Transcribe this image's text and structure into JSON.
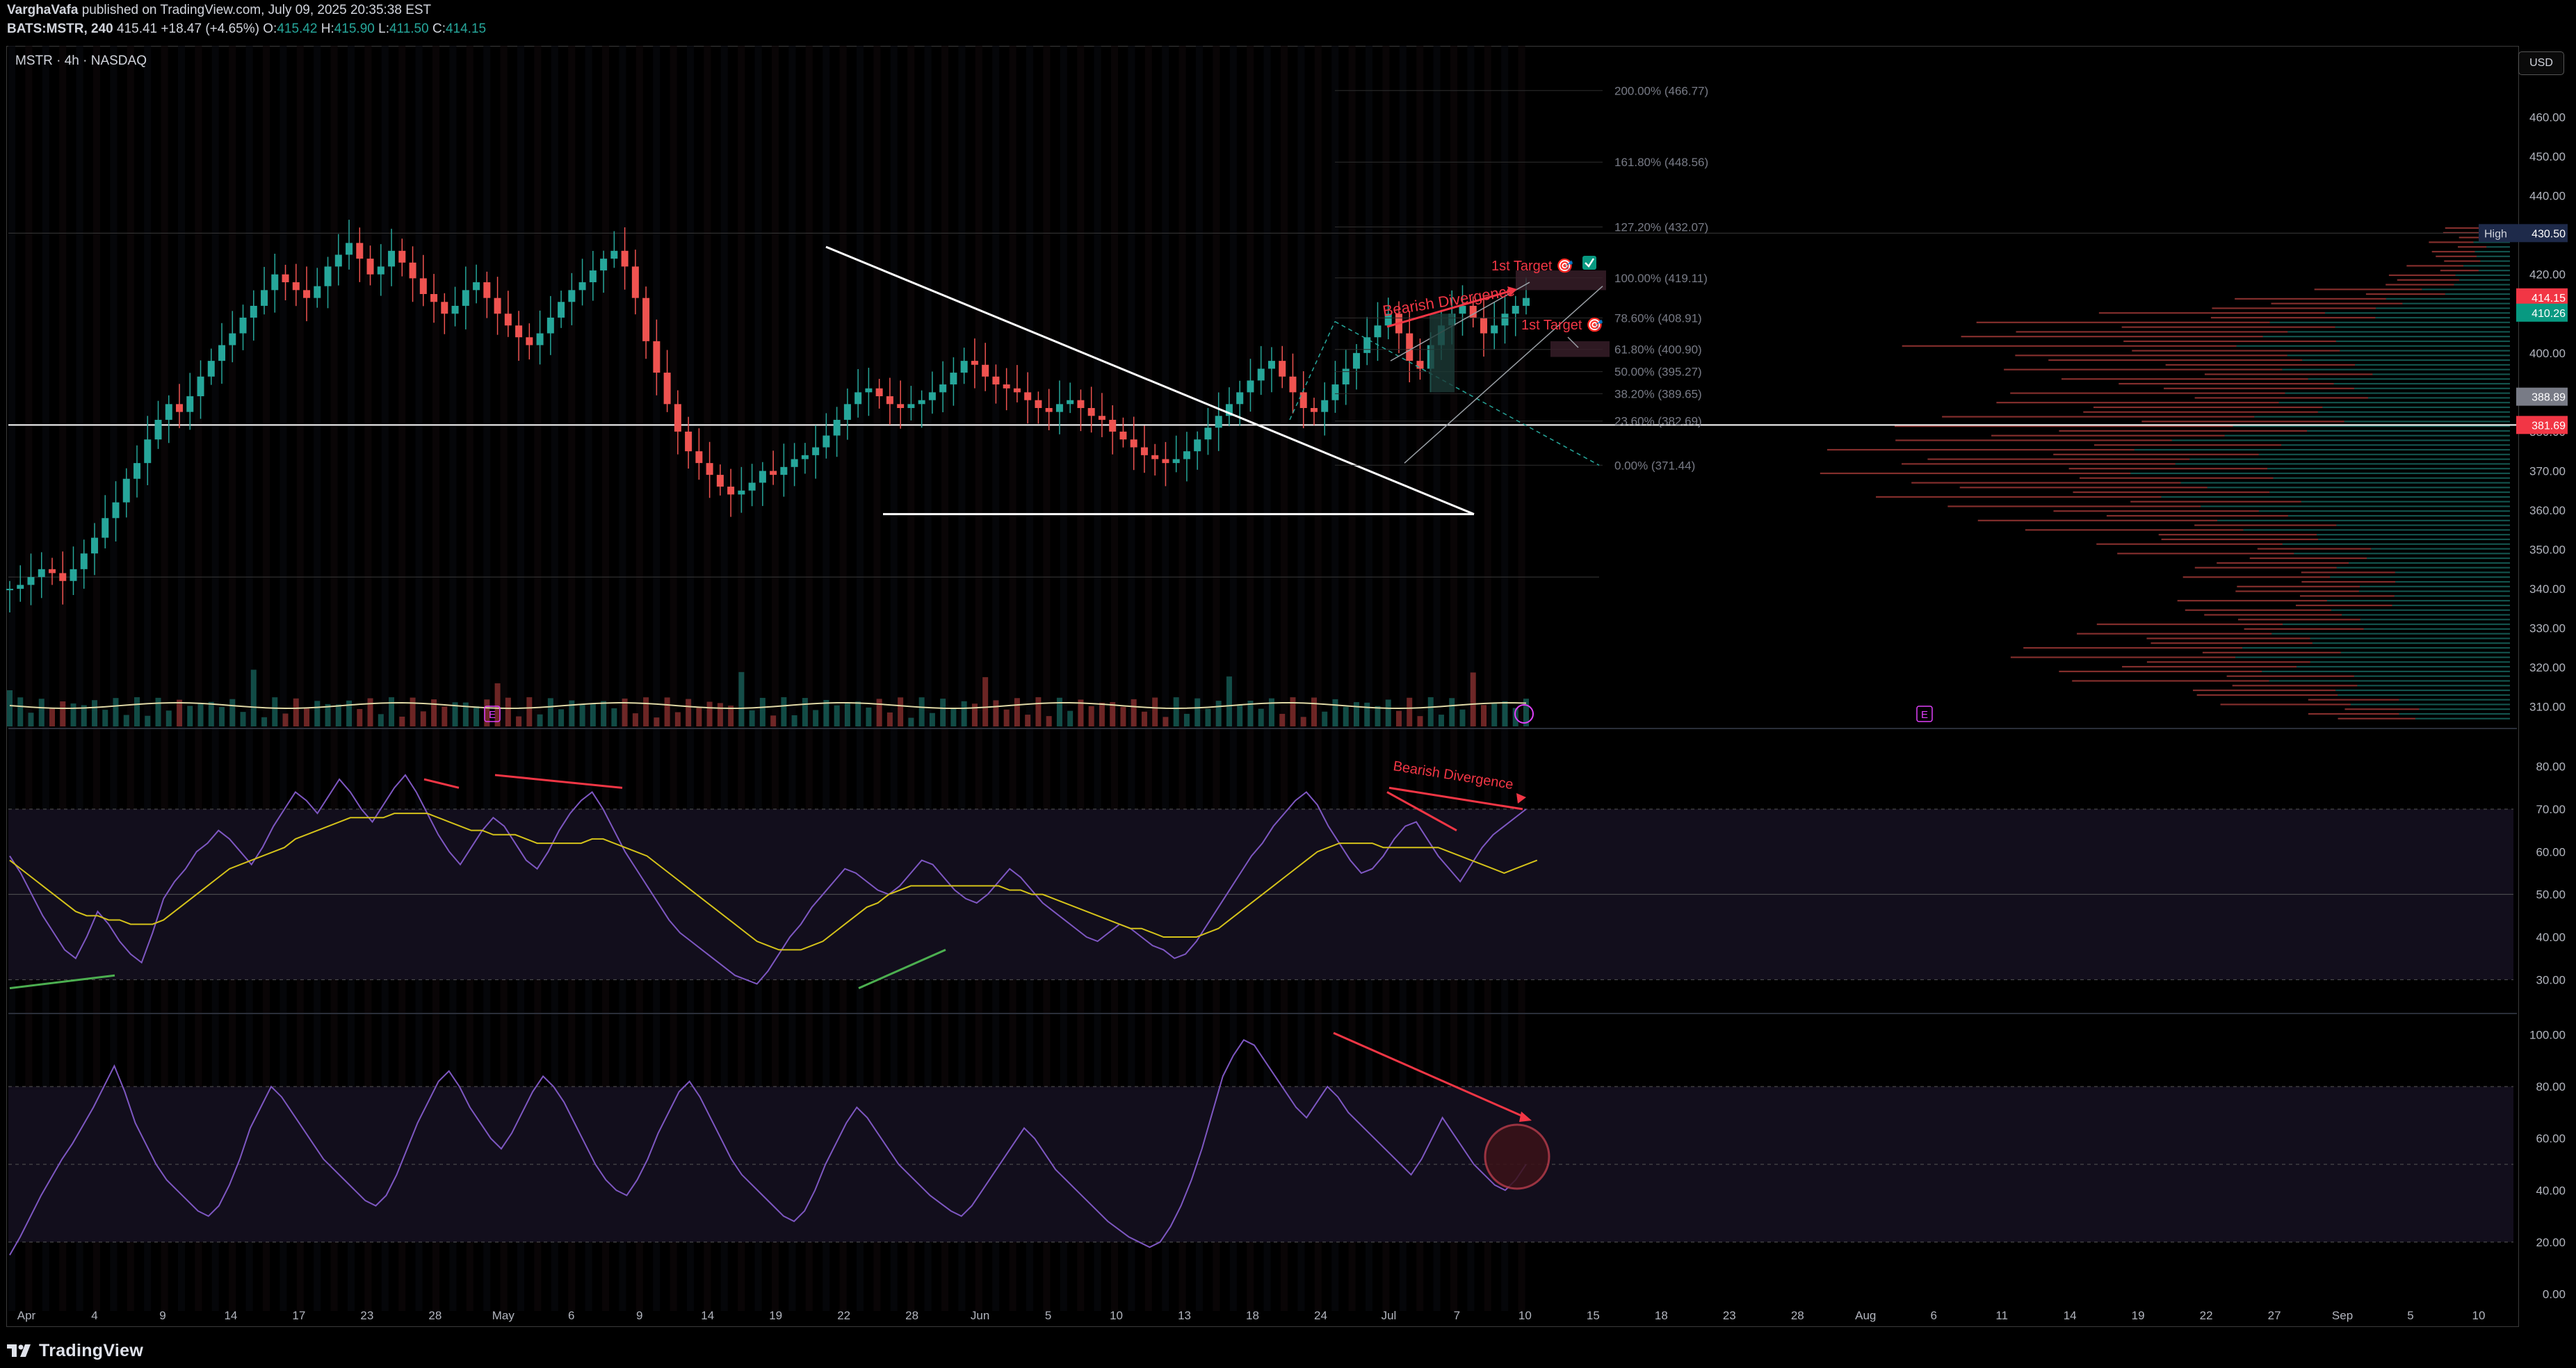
{
  "header": {
    "publisher": "VarghaVafa",
    "published_text": "published on TradingView.com, July 09, 2025 20:35:38 EST",
    "symbol_line": "BATS:MSTR, 240",
    "last": "415.41",
    "change": "+18.47 (+4.65%)",
    "o_label": "O:",
    "o": "415.42",
    "h_label": "H:",
    "h": "415.90",
    "l_label": "L:",
    "l": "411.50",
    "c_label": "C:",
    "c": "414.15"
  },
  "chart_title": "MSTR · 4h · NASDAQ",
  "currency": "USD",
  "footer": {
    "brand": "TradingView"
  },
  "colors": {
    "up": "#26a69a",
    "down": "#ef5350",
    "rsi": "#7e57c2",
    "ma": "#d4c21a",
    "annot": "#f23645",
    "trend": "#ffffff",
    "fib": "#787b86"
  },
  "chart_data": [
    {
      "type": "candlestick",
      "title": "MSTR · 4h · NASDAQ",
      "x_labels": [
        "Apr",
        "4",
        "9",
        "14",
        "17",
        "23",
        "28",
        "May",
        "6",
        "9",
        "14",
        "19",
        "22",
        "28",
        "Jun",
        "5",
        "10",
        "13",
        "18",
        "24",
        "Jul",
        "7",
        "10",
        "15",
        "18",
        "23",
        "28",
        "Aug",
        "6",
        "11",
        "14",
        "19",
        "22",
        "27",
        "Sep",
        "5",
        "10"
      ],
      "ylim": [
        305,
        470
      ],
      "y_ticks": [
        "460.00",
        "450.00",
        "440.00",
        "420.00",
        "410.00",
        "400.00",
        "390.00",
        "380.00",
        "370.00",
        "360.00",
        "350.00",
        "340.00",
        "330.00",
        "320.00",
        "310.00"
      ],
      "price_badges": [
        {
          "label": "High",
          "value": "430.50"
        },
        {
          "value": "414.15"
        },
        {
          "value": "410.26"
        },
        {
          "value": "388.89"
        },
        {
          "value": "381.69"
        }
      ],
      "fib_levels": [
        {
          "label": "200.00% (466.77)",
          "value": 466.77
        },
        {
          "label": "161.80% (448.56)",
          "value": 448.56
        },
        {
          "label": "127.20% (432.07)",
          "value": 432.07
        },
        {
          "label": "100.00% (419.11)",
          "value": 419.11
        },
        {
          "label": "78.60% (408.91)",
          "value": 408.91
        },
        {
          "label": "61.80% (400.90)",
          "value": 400.9
        },
        {
          "label": "50.00% (395.27)",
          "value": 395.27
        },
        {
          "label": "38.20% (389.65)",
          "value": 389.65
        },
        {
          "label": "23.60% (382.69)",
          "value": 382.69
        },
        {
          "label": "0.00% (371.44)",
          "value": 371.44
        }
      ],
      "annotations": [
        "Bearish Divergence",
        "1st Target 🎯",
        "1st Target 🎯"
      ],
      "earnings_markers": [
        "E",
        "E"
      ],
      "close_series": [
        340,
        341,
        343,
        345,
        344,
        342,
        345,
        349,
        353,
        358,
        362,
        368,
        372,
        378,
        383,
        387,
        385,
        389,
        394,
        398,
        402,
        405,
        409,
        412,
        416,
        420,
        418,
        416,
        414,
        417,
        422,
        425,
        428,
        424,
        420,
        422,
        426,
        423,
        419,
        415,
        413,
        410,
        412,
        416,
        418,
        414,
        410,
        407,
        404,
        402,
        405,
        409,
        413,
        416,
        418,
        421,
        424,
        426,
        422,
        414,
        403,
        395,
        387,
        380,
        375,
        372,
        369,
        366,
        364,
        365,
        367,
        370,
        369,
        371,
        373,
        374,
        376,
        379,
        383,
        387,
        390,
        391,
        389,
        387,
        386,
        387,
        388,
        390,
        392,
        395,
        398,
        397,
        394,
        392,
        391,
        390,
        388,
        386,
        385,
        387,
        388,
        386,
        384,
        383,
        380,
        378,
        376,
        374,
        373,
        372,
        373,
        375,
        378,
        381,
        384,
        387,
        390,
        393,
        396,
        398,
        394,
        390,
        386,
        385,
        388,
        392,
        396,
        400,
        404,
        407,
        410,
        405,
        398,
        396,
        402,
        407,
        410,
        412,
        409,
        405,
        407,
        410,
        412,
        414
      ]
    },
    {
      "type": "line",
      "title": "",
      "ylim": [
        25,
        85
      ],
      "y_ticks": [
        "80.00",
        "70.00",
        "60.00",
        "50.00",
        "40.00",
        "30.00"
      ],
      "levels": [
        70,
        50,
        30
      ],
      "annotations": [
        "Bearish Divergence"
      ],
      "series": [
        {
          "values": [
            59,
            55,
            50,
            45,
            41,
            37,
            35,
            40,
            46,
            43,
            39,
            36,
            34,
            41,
            49,
            53,
            56,
            60,
            62,
            65,
            63,
            60,
            57,
            61,
            66,
            70,
            74,
            72,
            69,
            73,
            77,
            74,
            70,
            67,
            71,
            75,
            78,
            74,
            69,
            64,
            60,
            57,
            61,
            65,
            68,
            66,
            62,
            58,
            56,
            60,
            65,
            69,
            72,
            74,
            70,
            65,
            60,
            56,
            52,
            48,
            44,
            41,
            39,
            37,
            35,
            33,
            31,
            30,
            29,
            32,
            36,
            40,
            43,
            47,
            50,
            53,
            56,
            55,
            53,
            51,
            50,
            52,
            55,
            58,
            57,
            54,
            51,
            49,
            48,
            50,
            53,
            56,
            54,
            51,
            48,
            46,
            44,
            42,
            40,
            39,
            41,
            43,
            42,
            40,
            38,
            37,
            35,
            36,
            39,
            43,
            47,
            51,
            55,
            59,
            62,
            66,
            69,
            72,
            74,
            71,
            66,
            62,
            58,
            55,
            56,
            59,
            63,
            66,
            67,
            63,
            59,
            56,
            53,
            57,
            61,
            64,
            66,
            68,
            70
          ]
        },
        {
          "values": [
            58,
            56,
            54,
            52,
            50,
            48,
            46,
            45,
            45,
            44,
            44,
            43,
            43,
            43,
            44,
            46,
            48,
            50,
            52,
            54,
            56,
            57,
            58,
            59,
            60,
            61,
            63,
            64,
            65,
            66,
            67,
            68,
            68,
            68,
            68,
            69,
            69,
            69,
            69,
            68,
            67,
            66,
            65,
            65,
            64,
            64,
            64,
            63,
            62,
            62,
            62,
            62,
            62,
            63,
            63,
            62,
            61,
            60,
            59,
            57,
            55,
            53,
            51,
            49,
            47,
            45,
            43,
            41,
            39,
            38,
            37,
            37,
            37,
            38,
            39,
            41,
            43,
            45,
            47,
            48,
            50,
            51,
            52,
            52,
            52,
            52,
            52,
            52,
            52,
            52,
            52,
            51,
            51,
            50,
            50,
            49,
            48,
            47,
            46,
            45,
            44,
            43,
            42,
            42,
            41,
            40,
            40,
            40,
            40,
            41,
            42,
            44,
            46,
            48,
            50,
            52,
            54,
            56,
            58,
            60,
            61,
            62,
            62,
            62,
            62,
            61,
            61,
            61,
            61,
            61,
            61,
            60,
            59,
            58,
            57,
            56,
            55,
            56,
            57,
            58
          ]
        }
      ]
    },
    {
      "type": "line",
      "title": "",
      "ylim": [
        -5,
        105
      ],
      "y_ticks": [
        "100.00",
        "80.00",
        "60.00",
        "40.00",
        "20.00",
        "0.00"
      ],
      "levels": [
        80,
        50,
        20
      ],
      "series": [
        {
          "values": [
            15,
            22,
            30,
            38,
            45,
            52,
            58,
            65,
            72,
            80,
            88,
            78,
            66,
            58,
            50,
            44,
            40,
            36,
            32,
            30,
            34,
            42,
            52,
            64,
            72,
            80,
            76,
            70,
            64,
            58,
            52,
            48,
            44,
            40,
            36,
            34,
            38,
            46,
            56,
            66,
            74,
            82,
            86,
            80,
            72,
            66,
            60,
            56,
            62,
            70,
            78,
            84,
            80,
            74,
            66,
            58,
            50,
            44,
            40,
            38,
            44,
            52,
            62,
            70,
            78,
            82,
            76,
            68,
            60,
            52,
            46,
            42,
            38,
            34,
            30,
            28,
            32,
            40,
            50,
            58,
            66,
            72,
            68,
            62,
            56,
            50,
            46,
            42,
            38,
            35,
            32,
            30,
            34,
            40,
            46,
            52,
            58,
            64,
            60,
            54,
            48,
            44,
            40,
            36,
            32,
            28,
            25,
            22,
            20,
            18,
            20,
            26,
            34,
            44,
            56,
            70,
            84,
            92,
            98,
            96,
            90,
            84,
            78,
            72,
            68,
            74,
            80,
            76,
            70,
            66,
            62,
            58,
            54,
            50,
            46,
            52,
            60,
            68,
            62,
            56,
            50,
            46,
            42,
            40,
            44,
            50
          ]
        }
      ]
    }
  ]
}
